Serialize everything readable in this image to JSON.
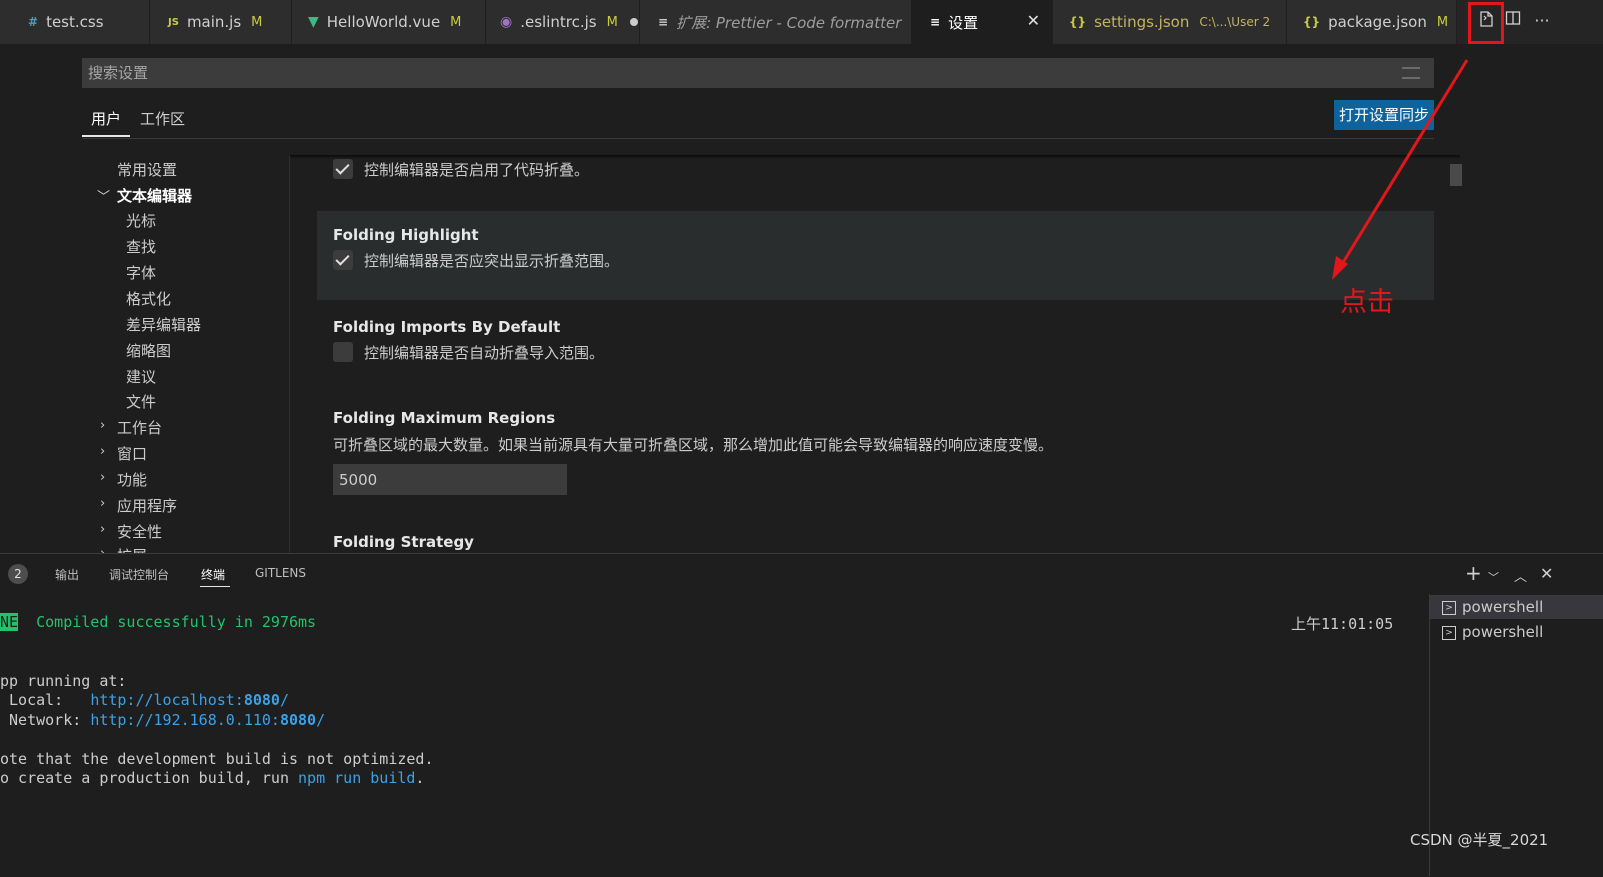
{
  "tabs": [
    {
      "icon": "#",
      "label": "test.css",
      "modified": "",
      "color": "#519aba"
    },
    {
      "icon": "JS",
      "label": "main.js",
      "modified": "M",
      "color": "#cbcb41"
    },
    {
      "icon": "▼",
      "label": "HelloWorld.vue",
      "modified": "M",
      "color": "#41b883"
    },
    {
      "icon": "◉",
      "label": ".eslintrc.js",
      "modified": "M",
      "color": "#a074c4"
    },
    {
      "icon": "≡",
      "label": "扩展: Prettier - Code formatter",
      "modified": "",
      "color": "#cccccc"
    },
    {
      "icon": "≡",
      "label": "设置",
      "modified": "",
      "color": "#cccccc"
    },
    {
      "icon": "{}",
      "label": "settings.json",
      "description": "C:\\...\\User 2",
      "modified": "",
      "color": "#cbcb41"
    },
    {
      "icon": "{}",
      "label": "package.json",
      "modified": "M",
      "color": "#cbcb41"
    }
  ],
  "tab_close": "✕",
  "search": {
    "placeholder": "搜索设置"
  },
  "scopes": {
    "user": "用户",
    "workspace": "工作区"
  },
  "sync_button": "打开设置同步",
  "tree": {
    "common": "常用设置",
    "text_editor": "文本编辑器",
    "children": [
      "光标",
      "查找",
      "字体",
      "格式化",
      "差异编辑器",
      "缩略图",
      "建议",
      "文件"
    ],
    "collapsed": [
      "工作台",
      "窗口",
      "功能",
      "应用程序",
      "安全性",
      "扩展"
    ]
  },
  "settings": {
    "folding_desc": "控制编辑器是否启用了代码折叠。",
    "highlight_title": "Folding Highlight",
    "highlight_desc": "控制编辑器是否应突出显示折叠范围。",
    "imports_title": "Folding Imports By Default",
    "imports_desc": "控制编辑器是否自动折叠导入范围。",
    "max_regions_title": "Folding Maximum Regions",
    "max_regions_desc": "可折叠区域的最大数量。如果当前源具有大量可折叠区域，那么增加此值可能会导致编辑器的响应速度变慢。",
    "max_regions_value": "5000",
    "strategy_title": "Folding Strategy"
  },
  "annotation": {
    "text": "点击",
    "color": "#e3161c"
  },
  "panel": {
    "badge": "2",
    "tabs": [
      "输出",
      "调试控制台",
      "终端",
      "GITLENS"
    ],
    "timestamp": "上午11:01:05",
    "shells": [
      "powershell",
      "powershell"
    ]
  },
  "terminal": {
    "done_tag": "NE",
    "compiled": "Compiled successfully in 2976ms",
    "app_running": "pp running at:",
    "local_label": " Local:   ",
    "local_url": "http://localhost:",
    "local_port": "8080",
    "network_label": " Network: ",
    "network_url": "http://192.168.0.110:",
    "network_port": "8080",
    "note1": "ote that the development build is not optimized.",
    "note2_a": "o create a production build, run ",
    "note2_b": "npm run build",
    "note2_c": "."
  },
  "watermark": "CSDN @半夏_2021"
}
